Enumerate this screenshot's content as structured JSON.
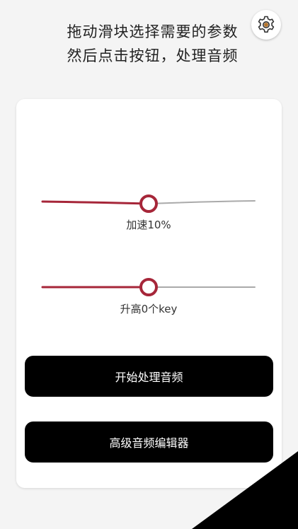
{
  "instruction": {
    "line1": "拖动滑块选择需要的参数",
    "line2": "然后点击按钮，处理音频"
  },
  "settings": {
    "icon": "gear-icon"
  },
  "speed_slider": {
    "label": "加速10%",
    "fraction": 0.5
  },
  "pitch_slider": {
    "label": "升高0个key",
    "fraction": 0.5
  },
  "buttons": {
    "start": "开始处理音频",
    "editor": "高级音频编辑器"
  },
  "colors": {
    "accent": "#a62639",
    "track_inactive": "#aaaaaa",
    "button_bg": "#000000",
    "button_text": "#ffffff"
  }
}
